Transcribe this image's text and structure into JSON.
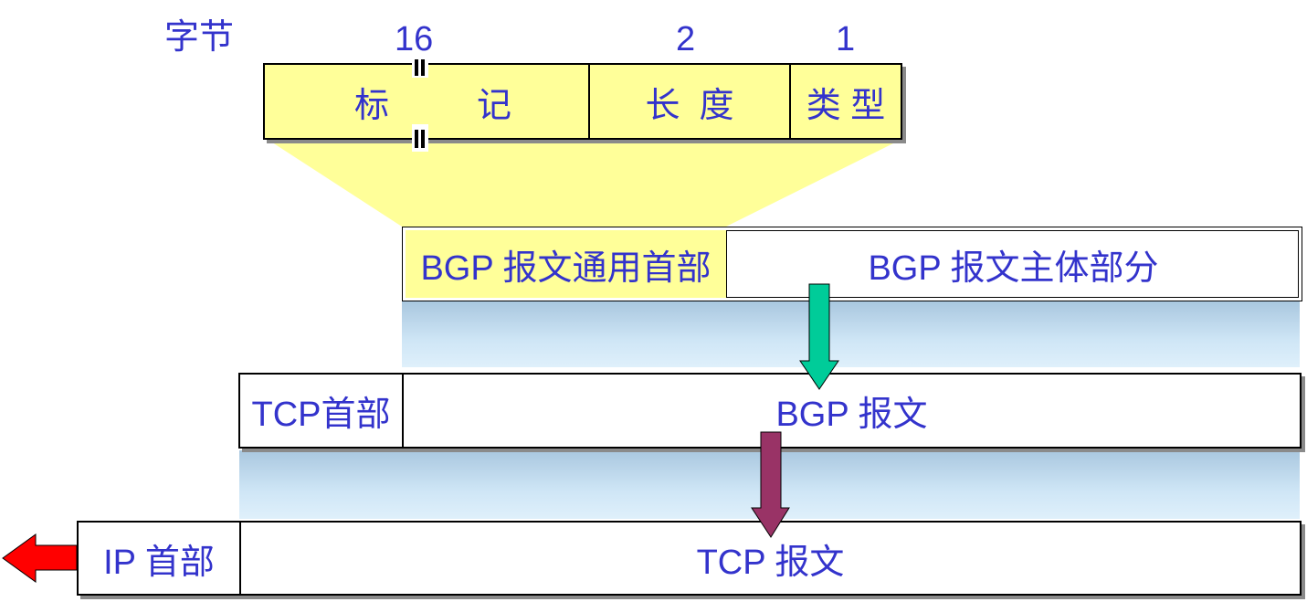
{
  "header": {
    "byte_label": "字节",
    "sizes": [
      "16",
      "2",
      "1"
    ],
    "fields": [
      "标",
      "记",
      "长  度",
      "类 型"
    ]
  },
  "bgp_row": {
    "general_header": "BGP 报文通用首部",
    "body": "BGP 报文主体部分"
  },
  "tcp_row": {
    "header": "TCP首部",
    "body": "BGP 报文"
  },
  "ip_row": {
    "header": "IP 首部",
    "body": "TCP 报文"
  },
  "colors": {
    "text": "#3333cc",
    "yellow": "#ffff99",
    "green_arrow": "#00cc99",
    "purple_arrow": "#993366",
    "red_arrow": "#ff0000",
    "band_light": "#cfe6f6"
  }
}
